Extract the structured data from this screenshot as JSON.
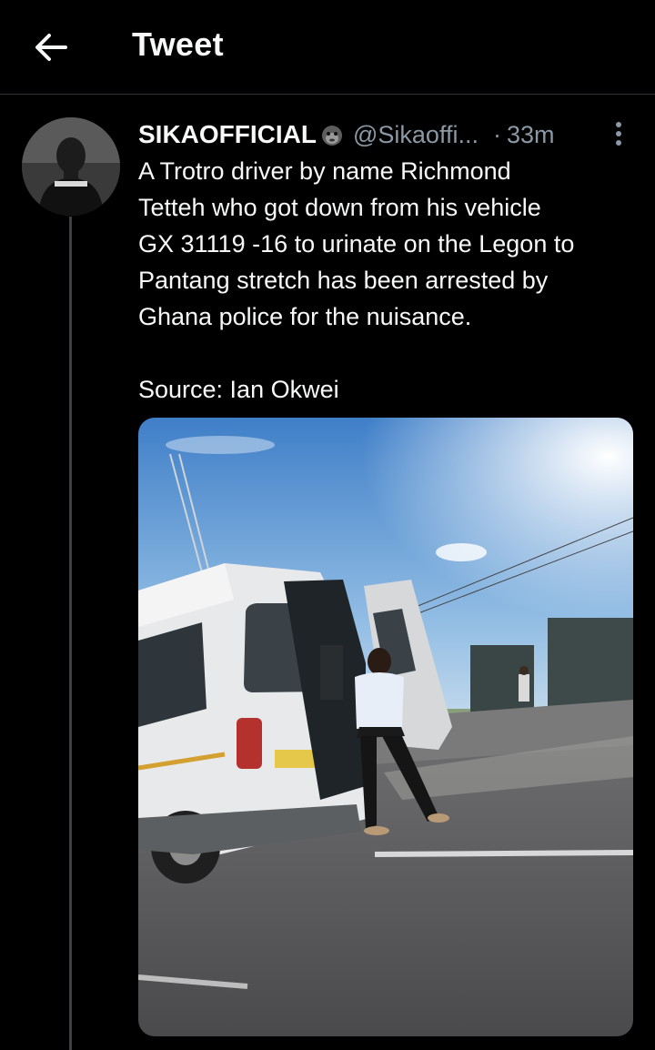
{
  "header": {
    "title": "Tweet",
    "back_icon": "arrow-left-icon"
  },
  "tweet": {
    "display_name": "SIKAOFFICIAL",
    "name_emoji": "gorilla-icon",
    "handle": "@Sikaoffi...",
    "separator": "·",
    "time": "33m",
    "text": "A Trotro driver by name Richmond\nTetteh who got down from his vehicle\nGX 31119 -16 to urinate on the Legon to\nPantang stretch has been arrested by\nGhana police for the nuisance.",
    "source": "Source: Ian Okwei",
    "more_icon": "more-vertical-icon"
  },
  "colors": {
    "background": "#000000",
    "text": "#f7f9f9",
    "secondary_text": "#8b98a5",
    "divider": "#2f3336"
  }
}
